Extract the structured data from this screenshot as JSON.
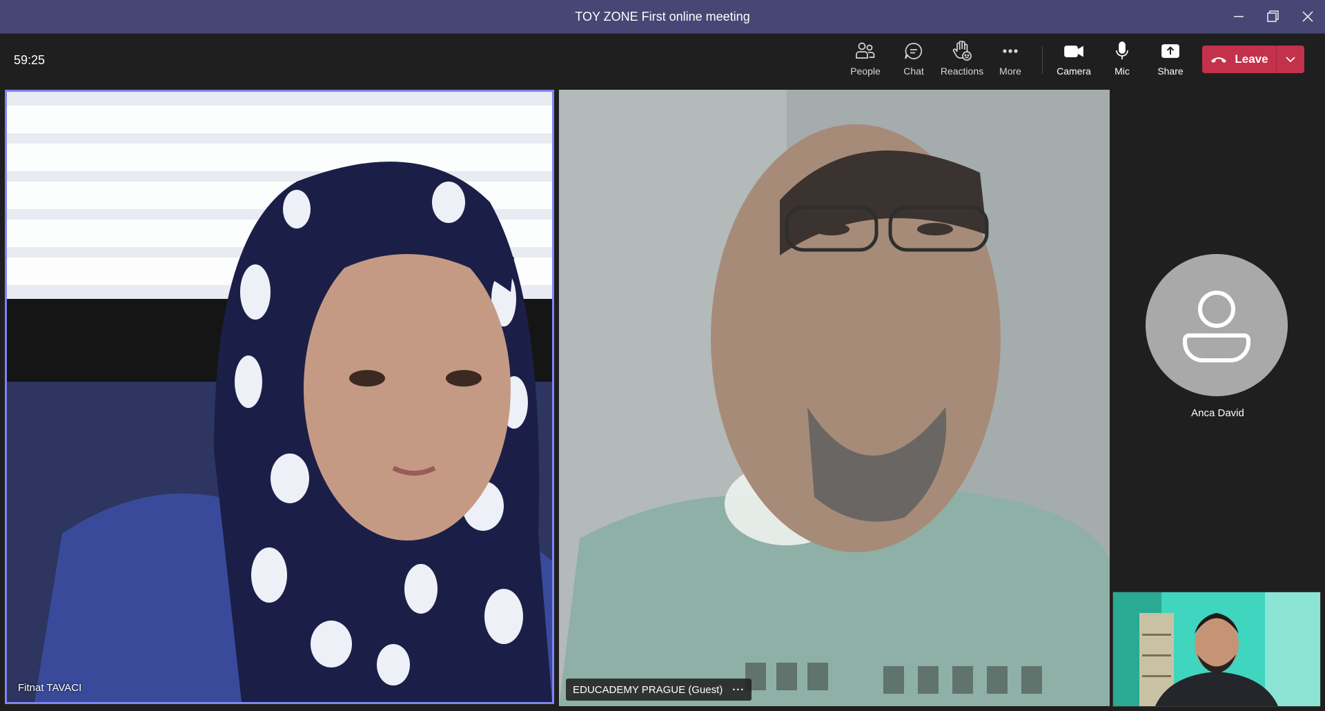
{
  "window": {
    "title": "TOY ZONE First online meeting",
    "controls": [
      "minimize-icon",
      "restore-icon",
      "close-icon"
    ]
  },
  "toolbar": {
    "timer": "59:25",
    "buttons": [
      {
        "label": "People",
        "icon": "people-icon"
      },
      {
        "label": "Chat",
        "icon": "chat-icon"
      },
      {
        "label": "Reactions",
        "icon": "raise-hand-icon"
      },
      {
        "label": "More",
        "icon": "more-icon"
      },
      {
        "label": "Camera",
        "icon": "camera-icon"
      },
      {
        "label": "Mic",
        "icon": "mic-icon"
      },
      {
        "label": "Share",
        "icon": "share-icon"
      }
    ],
    "leave": {
      "label": "Leave",
      "icon": "phone-hangup-icon",
      "accent": "#c4314b"
    }
  },
  "participants": [
    {
      "name": "Fitnat TAVACI",
      "active_speaker": true,
      "highlight": "#7f85f5"
    },
    {
      "name": "EDUCADEMY PRAGUE (Guest)",
      "more": "···"
    },
    {
      "name": "Anca David",
      "video": false,
      "icon": "person-icon"
    }
  ],
  "self_view": {
    "icon": "self-video-preview"
  },
  "colors": {
    "titlebar": "#464775",
    "background": "#1f1f1f",
    "accent": "#7f85f5"
  }
}
